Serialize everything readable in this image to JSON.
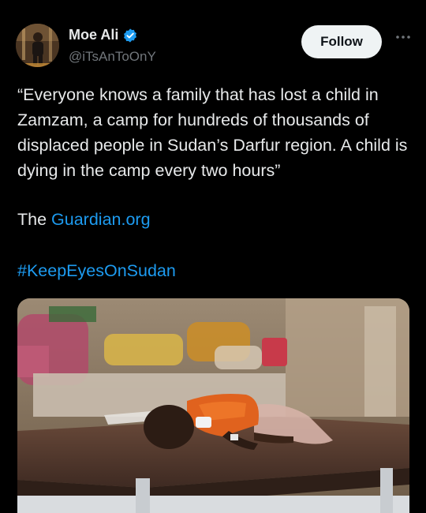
{
  "author": {
    "display_name": "Moe Ali",
    "handle": "@iTsAnToOnY",
    "verified": true,
    "avatar_icon": "person-avatar"
  },
  "actions": {
    "follow_label": "Follow",
    "more_icon": "more-horizontal-icon"
  },
  "tweet": {
    "text": "“Everyone knows a family that has lost a child in Zamzam, a camp for hundreds of thousands of displaced people in Sudan’s Darfur region. A child is dying in the camp every two hours”",
    "source_prefix": "The",
    "source_link": "Guardian.org",
    "hashtag": "#KeepEyesOnSudan"
  },
  "colors": {
    "background": "#000000",
    "text": "#e7e9ea",
    "secondary": "#71767b",
    "link": "#1d9bf0",
    "verified": "#1d9bf0",
    "follow_bg": "#eff3f4"
  }
}
